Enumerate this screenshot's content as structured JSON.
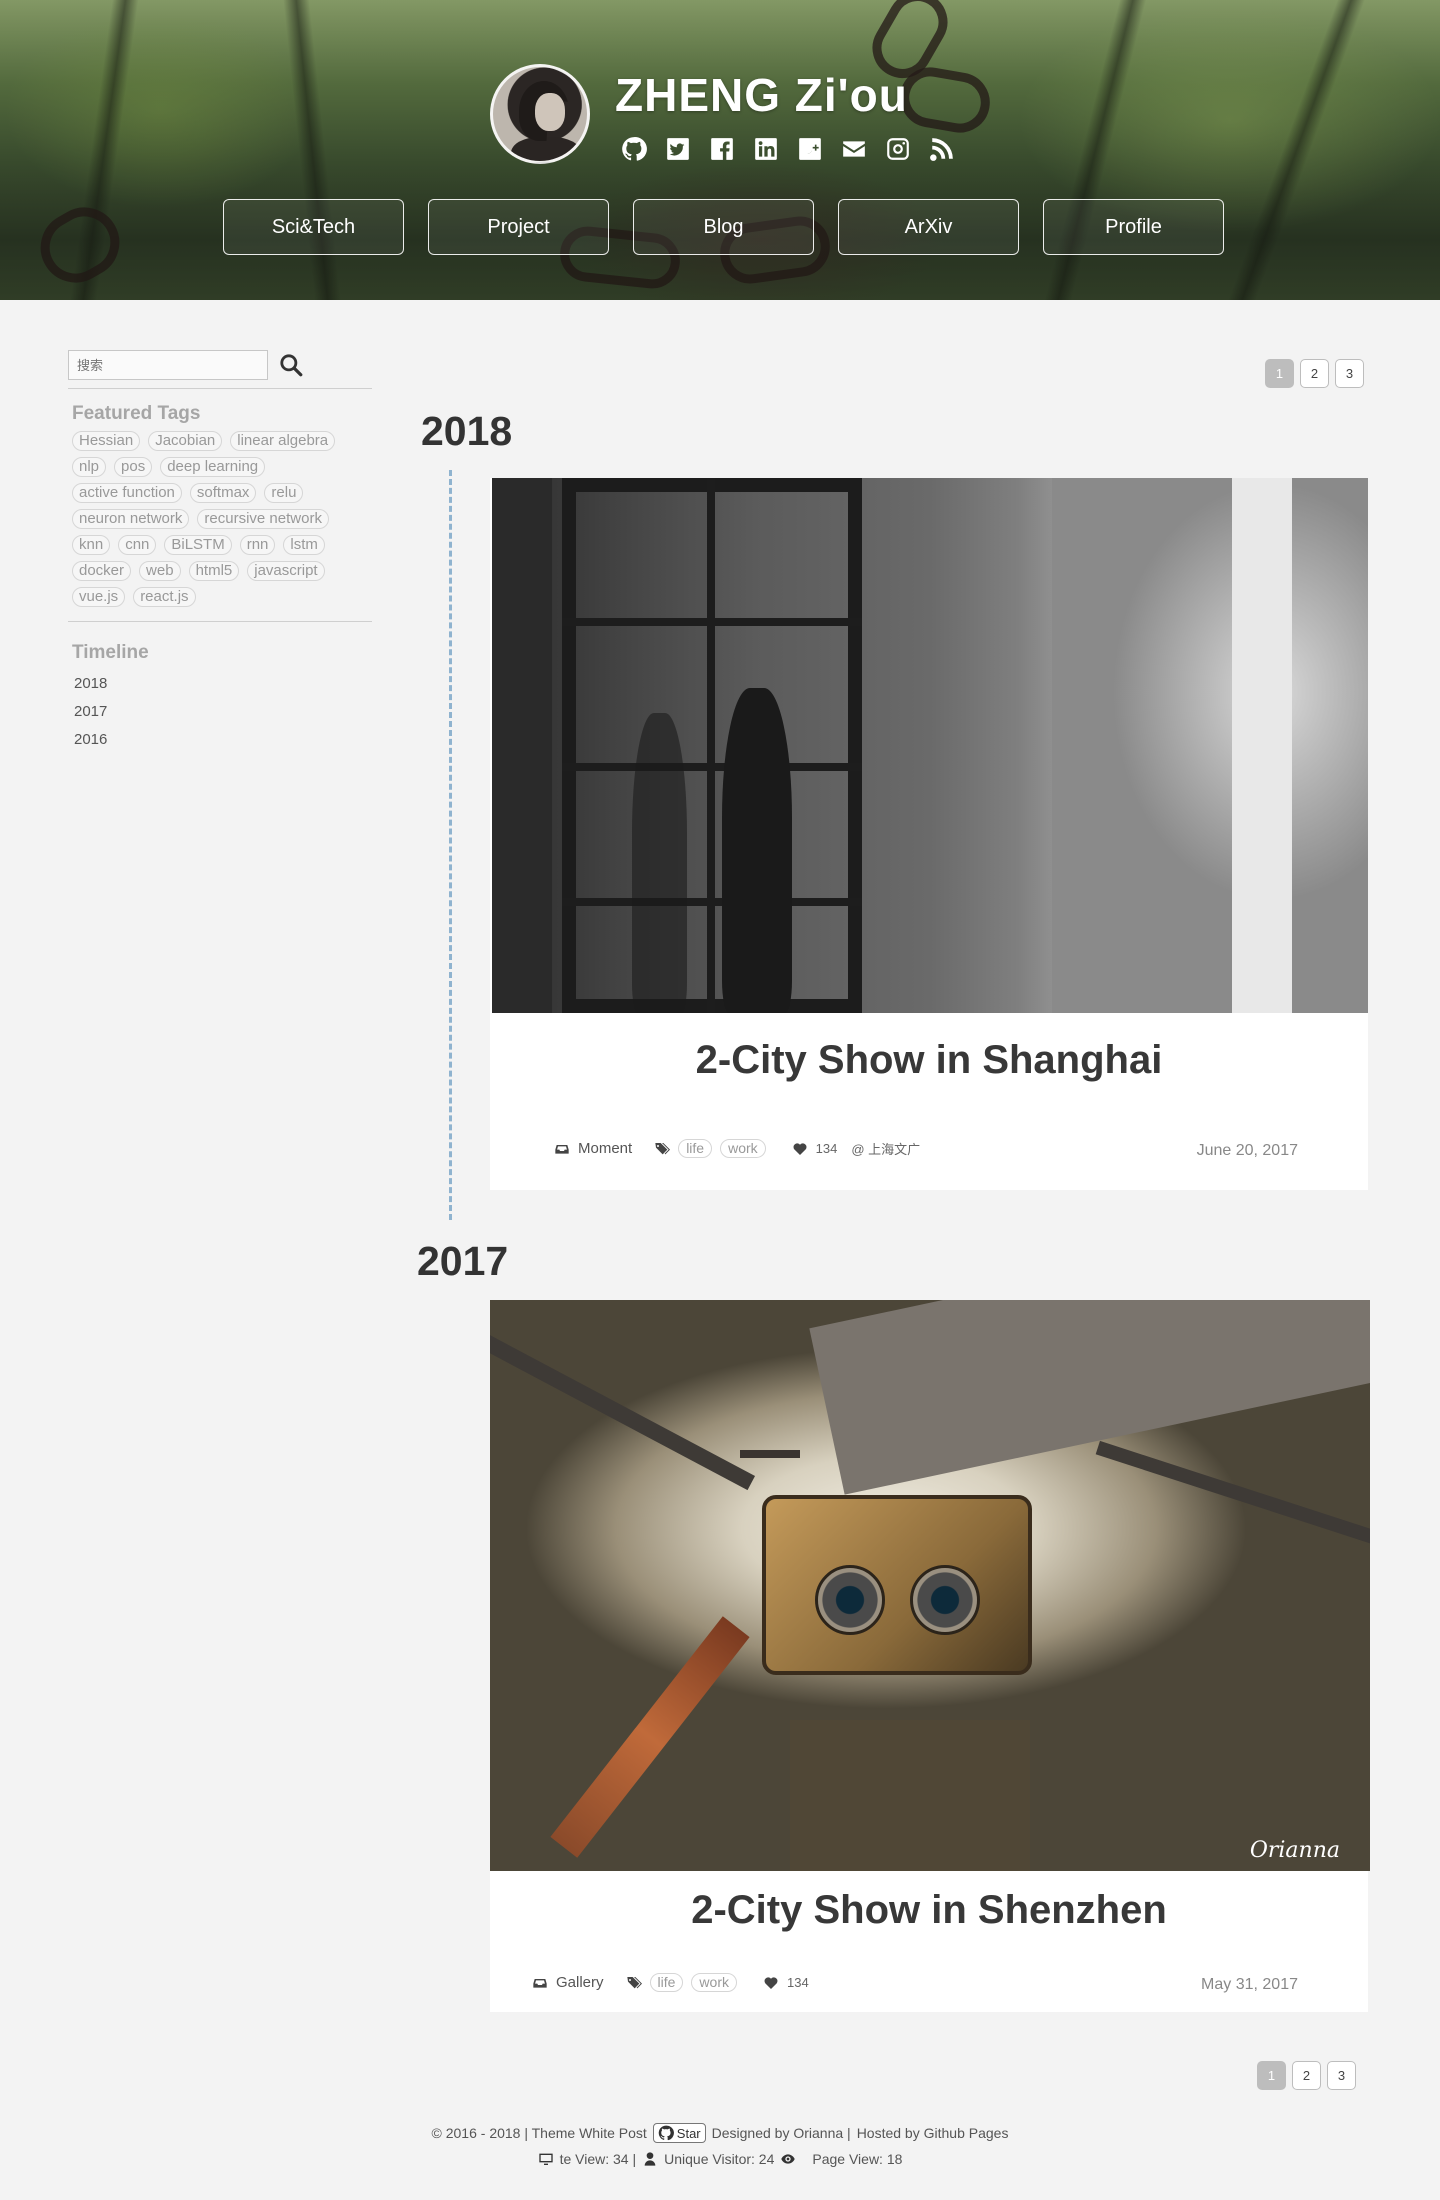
{
  "site": {
    "title": "ZHENG Zi'ou",
    "social_icons": [
      "github-icon",
      "twitter-icon",
      "facebook-icon",
      "linkedin-icon",
      "google-plus-icon",
      "mail-icon",
      "instagram-icon",
      "rss-icon"
    ]
  },
  "nav": [
    "Sci&Tech",
    "Project",
    "Blog",
    "ArXiv",
    "Profile"
  ],
  "sidebar": {
    "search_placeholder": "搜索",
    "featured_tags_title": "Featured Tags",
    "tags": [
      "Hessian",
      "Jacobian",
      "linear algebra",
      "nlp",
      "pos",
      "deep learning",
      "active function",
      "softmax",
      "relu",
      "neuron network",
      "recursive network",
      "knn",
      "cnn",
      "BiLSTM",
      "rnn",
      "lstm",
      "docker",
      "web",
      "html5",
      "javascript",
      "vue.js",
      "react.js"
    ],
    "timeline_title": "Timeline",
    "timeline": [
      "2018",
      "2017",
      "2016"
    ]
  },
  "pagination": [
    "1",
    "2",
    "3"
  ],
  "posts": [
    {
      "year": "2018",
      "title": "2-City Show in Shanghai",
      "category": "Moment",
      "tags": [
        "life",
        "work"
      ],
      "likes": "134",
      "location": "@ 上海文广",
      "date": "June 20, 2017"
    },
    {
      "year": "2017",
      "title": "2-City Show in Shenzhen",
      "category": "Gallery",
      "tags": [
        "life",
        "work"
      ],
      "likes": "134",
      "date": "May 31, 2017",
      "watermark": "Orianna"
    }
  ],
  "footer": {
    "copyright": "© 2016 - 2018 | Theme White Post",
    "star": "Star",
    "designed": "Designed by Orianna |",
    "hosted": "Hosted by Github Pages",
    "site_view": "te View: 34 |",
    "unique_visitor": "Unique Visitor: 24",
    "page_view": "Page View: 18"
  },
  "colors": {
    "timeline_line": "#8fb3cf",
    "pager_active": "#bdbdbd"
  }
}
